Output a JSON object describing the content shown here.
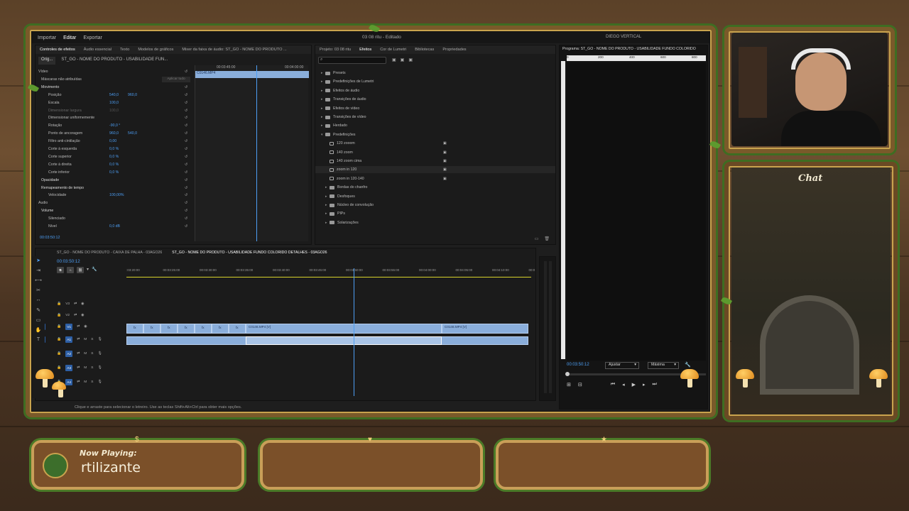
{
  "premiere": {
    "menu": {
      "items": [
        "Importar",
        "Editar",
        "Exportar"
      ],
      "active": "Editar"
    },
    "doc_title": "03 08 ritu - Editado",
    "workspace": "DIEGO VERTICAL",
    "effect_controls": {
      "tabs": [
        "Controles de efeitos",
        "Áudio essencial",
        "Texto",
        "Modelos de gráficos",
        "Mixer da faixa de áudio: ST_GO - NOME DO PRODUTO ..."
      ],
      "source_tabs": [
        "Orig...",
        "ST_GO - NOME DO PRODUTO - USABILIDADE FUN..."
      ],
      "time_start": "00:03:45:00",
      "time_end": "00:04:00:00",
      "clip_name": "C0146.MP4",
      "rows": [
        {
          "label": "Vídeo",
          "v1": "",
          "v2": ""
        },
        {
          "label": "Máscaras não atribuídas",
          "v1": "",
          "v2": ""
        },
        {
          "label": "Movimento",
          "v1": "",
          "v2": ""
        },
        {
          "label": "Posição",
          "v1": "540,0",
          "v2": "960,0"
        },
        {
          "label": "Escala",
          "v1": "100,0",
          "v2": ""
        },
        {
          "label": "Dimensionar largura",
          "v1": "100,0",
          "v2": ""
        },
        {
          "label": "Dimensionar uniformemente",
          "v1": "",
          "v2": ""
        },
        {
          "label": "Rotação",
          "v1": "-90,0 °",
          "v2": ""
        },
        {
          "label": "Ponto de ancoragem",
          "v1": "960,0",
          "v2": "540,0"
        },
        {
          "label": "Filtro anti-cintilação",
          "v1": "0,00",
          "v2": ""
        },
        {
          "label": "Corte à esquerda",
          "v1": "0,0 %",
          "v2": ""
        },
        {
          "label": "Corte superior",
          "v1": "0,0 %",
          "v2": ""
        },
        {
          "label": "Corte à direita",
          "v1": "0,0 %",
          "v2": ""
        },
        {
          "label": "Corte inferior",
          "v1": "0,0 %",
          "v2": ""
        },
        {
          "label": "Opacidade",
          "v1": "",
          "v2": ""
        },
        {
          "label": "Remapeamento de tempo",
          "v1": "",
          "v2": ""
        },
        {
          "label": "Velocidade",
          "v1": "100,00%",
          "v2": ""
        },
        {
          "label": "Áudio",
          "v1": "",
          "v2": ""
        },
        {
          "label": "Volume",
          "v1": "",
          "v2": ""
        },
        {
          "label": "Silenciado",
          "v1": "",
          "v2": ""
        },
        {
          "label": "Nível",
          "v1": "0,0 dB",
          "v2": ""
        }
      ],
      "apply_all": "Aplicar tudo",
      "timecode": "00:03:50:12"
    },
    "effects_panel": {
      "tabs": [
        "Projeto: 03 08 ritu",
        "Efeitos",
        "Cor de Lumetri",
        "Bibliotecas",
        "Propriedades"
      ],
      "active_tab": "Efeitos",
      "items": [
        {
          "label": "Presets",
          "level": 0
        },
        {
          "label": "Predefinições de Lumetri",
          "level": 0
        },
        {
          "label": "Efeitos de áudio",
          "level": 0
        },
        {
          "label": "Transições de áudio",
          "level": 0
        },
        {
          "label": "Efeitos de vídeo",
          "level": 0
        },
        {
          "label": "Transições de vídeo",
          "level": 0
        },
        {
          "label": "Herdado",
          "level": 0
        },
        {
          "label": "Predefinições",
          "level": 0
        },
        {
          "label": "120 zooom",
          "level": 1
        },
        {
          "label": "140 zoom",
          "level": 1
        },
        {
          "label": "140 zoom cima",
          "level": 1
        },
        {
          "label": "zoom in 120",
          "level": 1
        },
        {
          "label": "zoom in 120-140",
          "level": 1
        },
        {
          "label": "Bordas do chanfro",
          "level": 1
        },
        {
          "label": "Desfoques",
          "level": 1
        },
        {
          "label": "Núcleo de convolução",
          "level": 1
        },
        {
          "label": "PIPs",
          "level": 1
        },
        {
          "label": "Solarizações",
          "level": 1
        }
      ]
    },
    "program": {
      "title": "Programa: ST_GO - NOME DO PRODUTO - USABILIDADE FUNDO COLORIDO",
      "ruler": [
        "0",
        "200",
        "400",
        "600",
        "800"
      ],
      "timecode": "00:03:50:12",
      "fit": "Ajustar",
      "quality": "Máxima"
    },
    "timeline": {
      "tabs": [
        "ST_GO - NOME DO PRODUTO - CAIXA DE PALHA - 03AGO26",
        "ST_GO - NOME DO PRODUTO - USABILIDADE FUNDO COLORIDO DETALHES - 03AGO26"
      ],
      "timecode": "00:03:50:12",
      "ruler": [
        ":03:20:00",
        "00:03:25:00",
        "00:03:30:00",
        "00:03:35:00",
        "00:03:40:00",
        "00:03:45:00",
        "00:03:50:00",
        "00:03:55:00",
        "00:04:00:00",
        "00:04:05:00",
        "00:04:10:00",
        "00:0"
      ],
      "tracks": [
        {
          "id": "V3",
          "type": "video"
        },
        {
          "id": "V2",
          "type": "video"
        },
        {
          "id": "V1",
          "type": "video"
        },
        {
          "id": "A1",
          "type": "audio"
        },
        {
          "id": "A2",
          "type": "audio"
        },
        {
          "id": "A3",
          "type": "audio"
        },
        {
          "id": "A4",
          "type": "audio"
        }
      ],
      "clip_a": "C0146.MP4 [V]",
      "clip_b": "C0146.MP4 [V]",
      "fx_label": "fx"
    },
    "status_bar": "Clique e arraste para selecionar o letreiro. Use as teclas Shift+Alt+Ctrl para obter mais opções."
  },
  "stream": {
    "chat_title": "Chat",
    "now_playing_label": "Now Playing:",
    "now_playing_user": "rtilizante"
  },
  "colors": {
    "premiere_bg": "#1e1e1e",
    "accent_blue": "#4d9ff5",
    "clip_blue": "#8aaedb",
    "frame_wood": "#7a5a2a",
    "vine_green": "#3e6d22",
    "panel_wood": "#7b5029"
  }
}
